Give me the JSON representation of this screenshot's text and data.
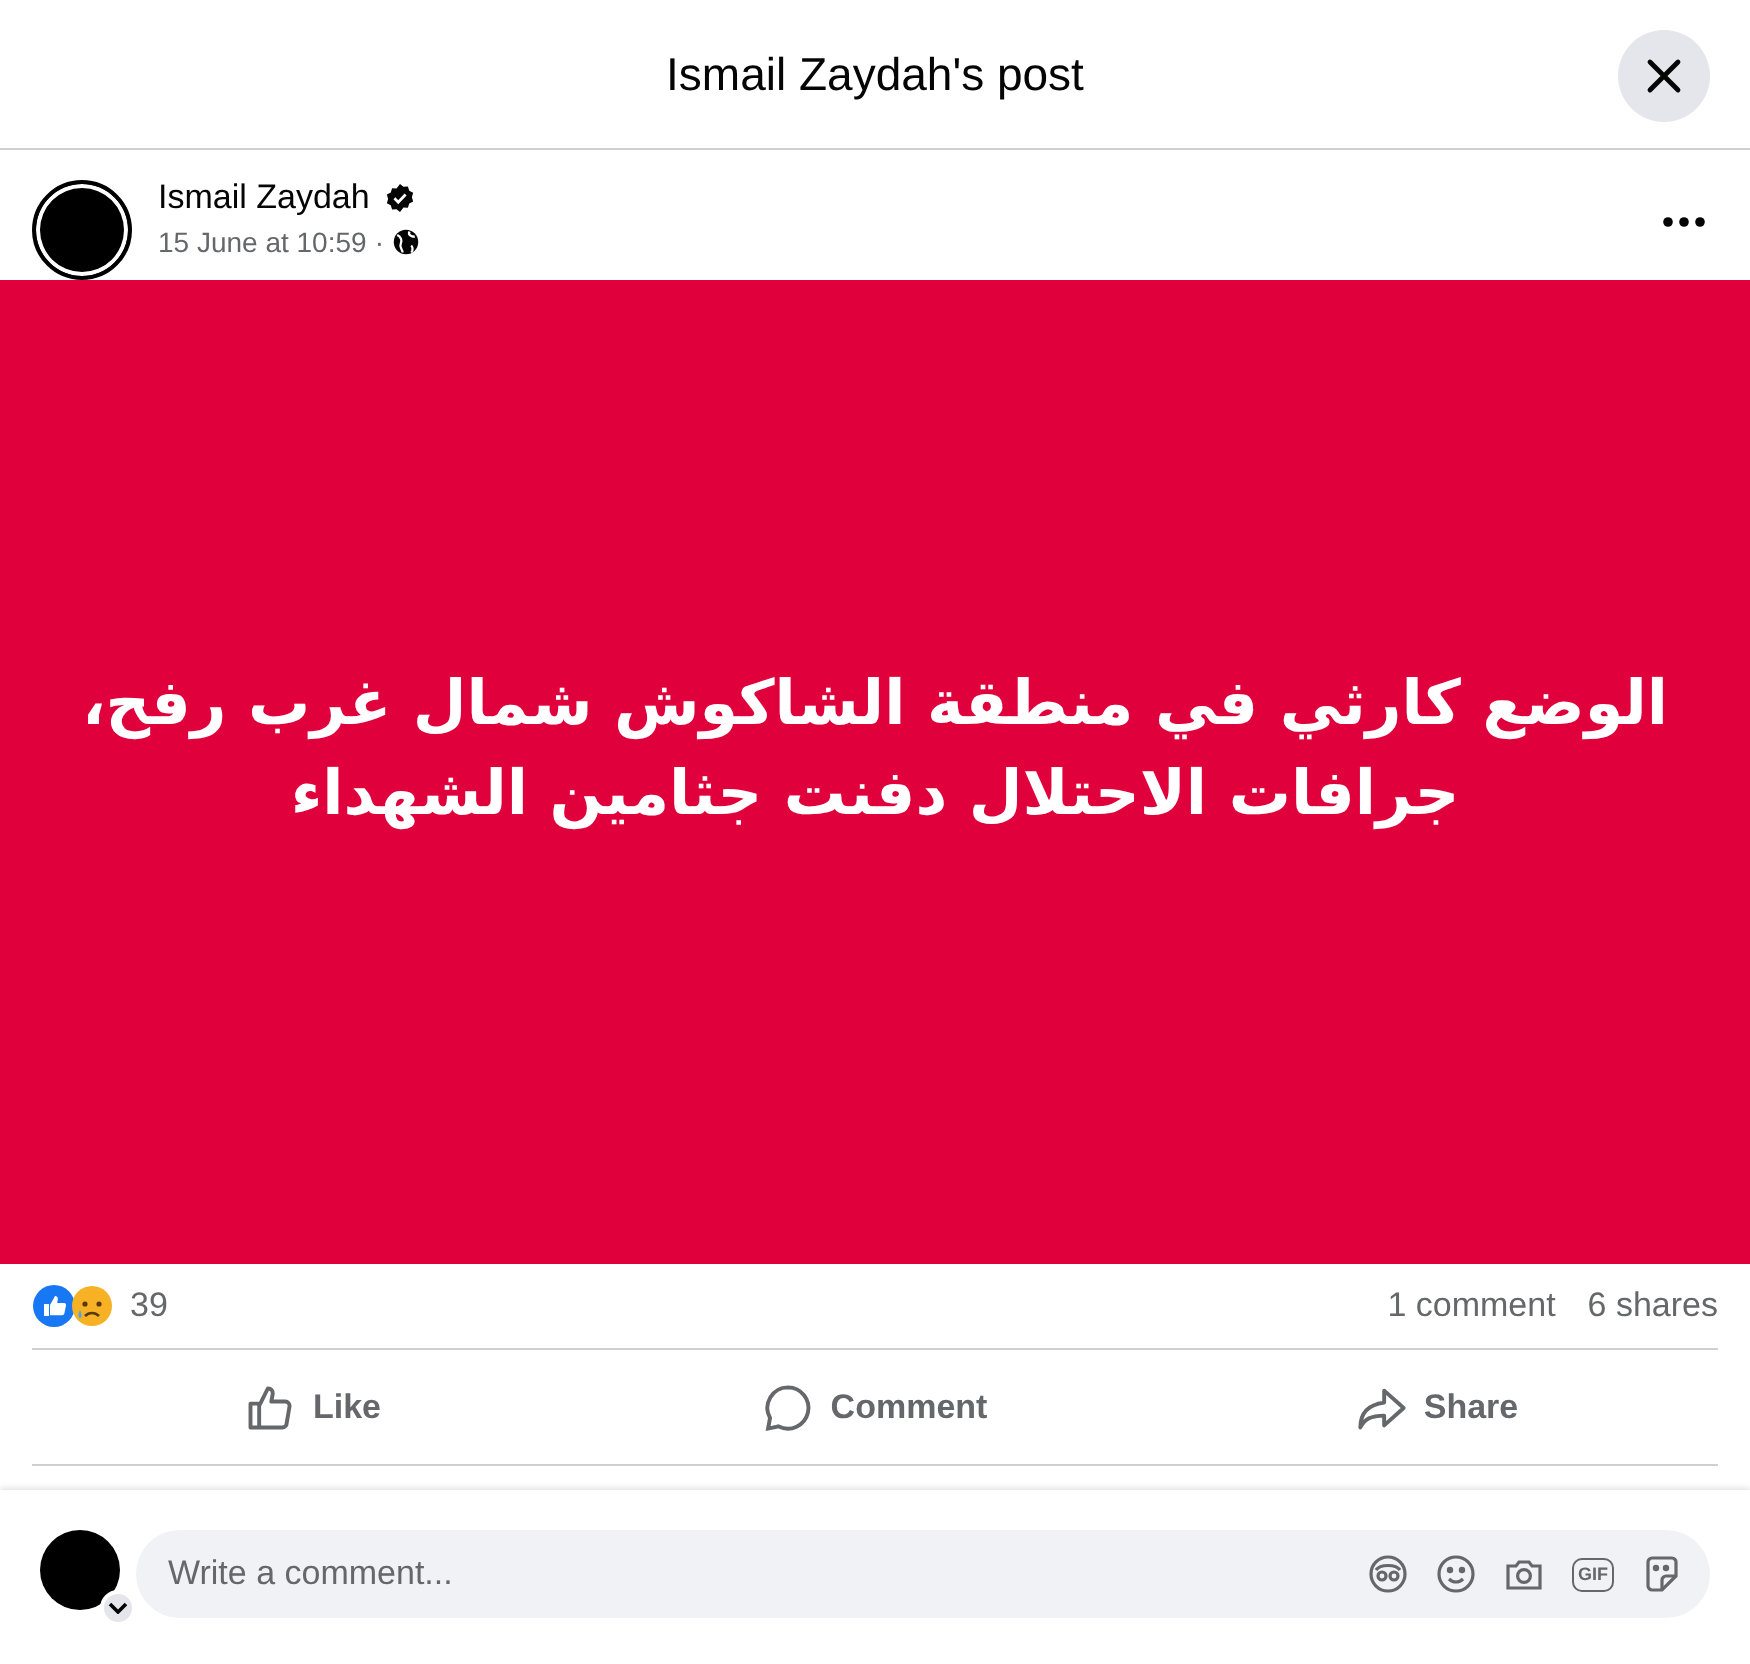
{
  "dialog": {
    "title": "Ismail Zaydah's post"
  },
  "post": {
    "author": "Ismail Zaydah",
    "verified": true,
    "time": "15 June at 10:59",
    "separator": "·",
    "image_text": "الوضع كارثي في منطقة الشاكوش شمال غرب رفح، جرافات الاحتلال دفنت جثامين الشهداء"
  },
  "stats": {
    "reactions_count": "39",
    "comments": "1 comment",
    "shares": "6 shares"
  },
  "actions": [
    {
      "kind": "like",
      "label": "Like"
    },
    {
      "kind": "comment",
      "label": "Comment"
    },
    {
      "kind": "share",
      "label": "Share"
    }
  ],
  "composer": {
    "placeholder": "Write a comment...",
    "gif_label": "GIF"
  }
}
